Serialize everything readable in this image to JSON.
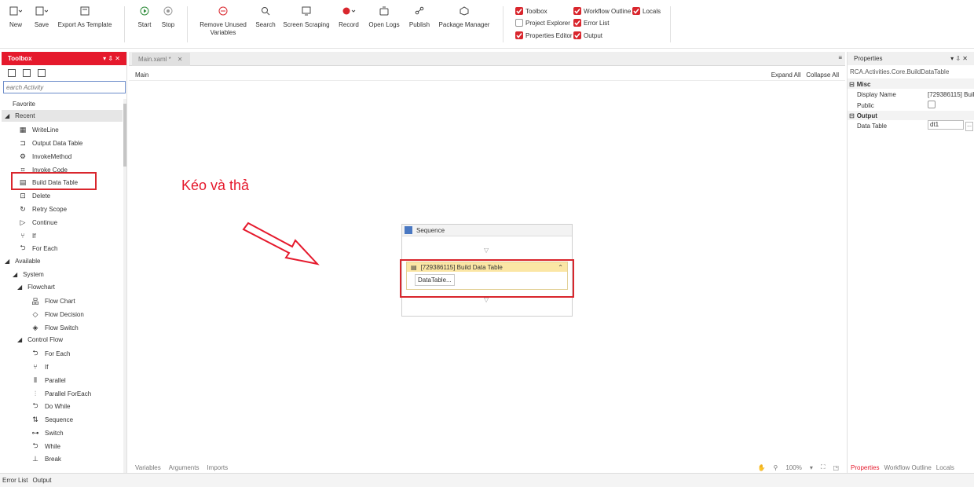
{
  "ribbon": {
    "new": "New",
    "save": "Save",
    "export": "Export As Template",
    "start": "Start",
    "stop": "Stop",
    "remove_unused_1": "Remove Unused",
    "remove_unused_2": "Variables",
    "search": "Search",
    "screen_scraping": "Screen Scraping",
    "record": "Record",
    "open_logs": "Open Logs",
    "publish": "Publish",
    "package_manager": "Package Manager",
    "checks": {
      "toolbox": "Toolbox",
      "workflow_outline": "Workflow Outline",
      "locals": "Locals",
      "project_explorer": "Project Explorer",
      "error_list": "Error List",
      "properties_editor": "Properties Editor",
      "output": "Output"
    }
  },
  "toolbox": {
    "title": "Toolbox",
    "search_placeholder": "earch Activity",
    "favorite": "Favorite",
    "recent": "Recent",
    "recent_items": [
      "WriteLine",
      "Output Data Table",
      "InvokeMethod",
      "Invoke Code",
      "Build Data Table",
      "Delete",
      "Retry Scope",
      "Continue",
      "If",
      "For Each"
    ],
    "available": "Available",
    "system": "System",
    "flowchart": "Flowchart",
    "flowchart_items": [
      "Flow Chart",
      "Flow Decision",
      "Flow Switch"
    ],
    "control_flow": "Control Flow",
    "control_items": [
      "For Each",
      "If",
      "Parallel",
      "Parallel ForEach",
      "Do While",
      "Sequence",
      "Switch",
      "While",
      "Break"
    ]
  },
  "tabs": {
    "main_tab": "Main.xaml *"
  },
  "designer": {
    "breadcrumb": "Main",
    "expand_all": "Expand All",
    "collapse_all": "Collapse All",
    "sequence_title": "Sequence",
    "activity_title": "[729386115] Build Data Table",
    "datatable_button": "DataTable...",
    "annotation": "Kéo và thả",
    "foot": {
      "variables": "Variables",
      "arguments": "Arguments",
      "imports": "Imports",
      "zoom": "100%"
    }
  },
  "properties": {
    "title": "Properties",
    "type_name": "RCA.Activities.Core.BuildDataTable",
    "misc": "Misc",
    "display_name_label": "Display Name",
    "display_name_value": "[729386115] Buil",
    "public_label": "Public",
    "output": "Output",
    "data_table_label": "Data Table",
    "data_table_value": "dt1",
    "ellipsis": "...",
    "tabs": [
      "Properties",
      "Workflow Outline",
      "Locals"
    ]
  },
  "statusbar": {
    "error_list": "Error List",
    "output": "Output"
  },
  "colors": {
    "accent": "#e5192c",
    "activity_header": "#fbe6a5",
    "checkbox_on": "#d9262d"
  }
}
